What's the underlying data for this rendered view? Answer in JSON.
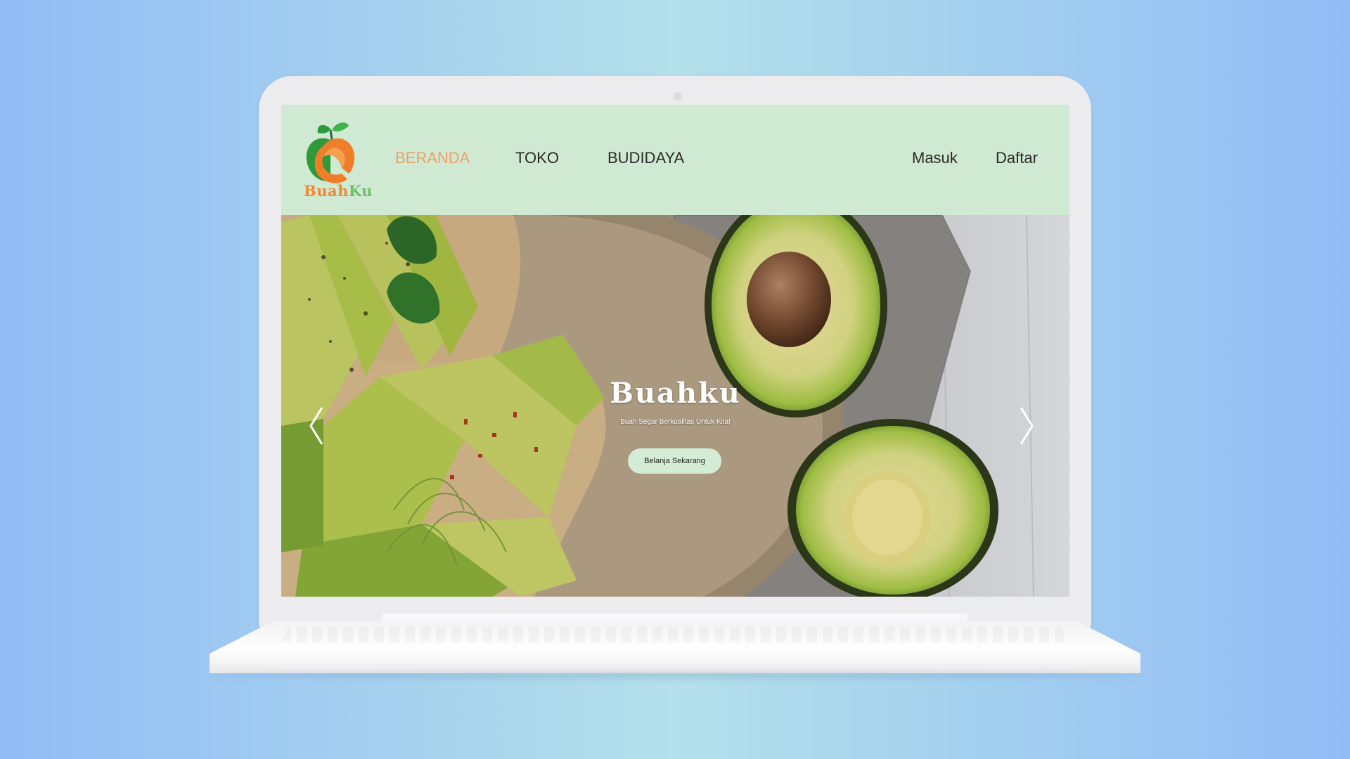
{
  "brand": {
    "logo_part1": "Buah",
    "logo_part2": "Ku",
    "accent_orange": "#ef8a35",
    "accent_green": "#6cc16a"
  },
  "nav": {
    "items": [
      {
        "label": "BERANDA",
        "active": true
      },
      {
        "label": "TOKO",
        "active": false
      },
      {
        "label": "BUDIDAYA",
        "active": false
      }
    ],
    "login_label": "Masuk",
    "register_label": "Daftar",
    "background": "#d0e9d2",
    "active_color": "#f0a06a"
  },
  "hero": {
    "title": "Buahku",
    "subtitle": "Buah Segar Berkualitas Untuk Kita!",
    "cta_label": "Belanja Sekarang",
    "prev_icon": "chevron-left-icon",
    "next_icon": "chevron-right-icon"
  }
}
